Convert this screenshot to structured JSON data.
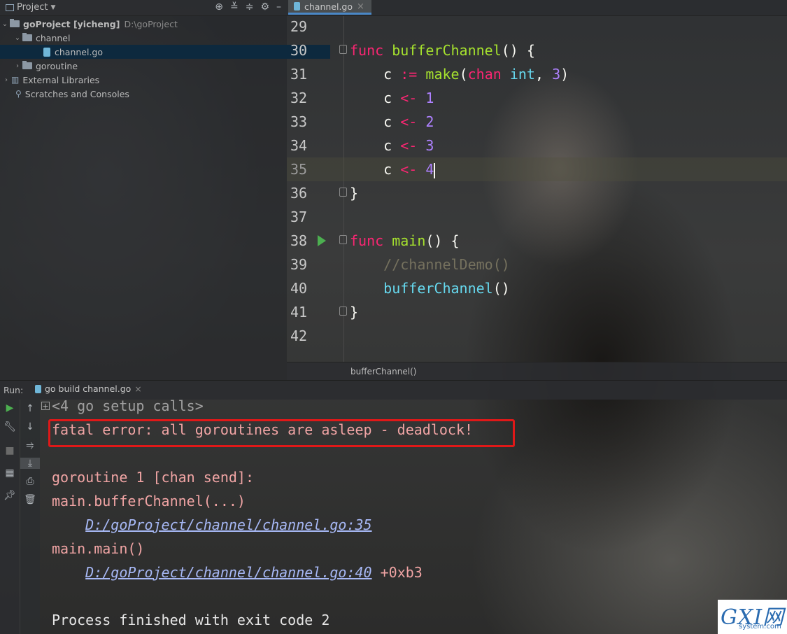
{
  "project_panel": {
    "title": "Project",
    "toolbar_icons": [
      "target-icon",
      "collapse-icon",
      "expand-icon",
      "gear-icon",
      "minimize-icon"
    ],
    "tree": [
      {
        "label": "goProject [yicheng]",
        "path": "D:\\goProject",
        "type": "folder",
        "expanded": true
      },
      {
        "label": "channel",
        "type": "folder",
        "expanded": true
      },
      {
        "label": "channel.go",
        "type": "go-file",
        "selected": true
      },
      {
        "label": "goroutine",
        "type": "folder",
        "expanded": false
      },
      {
        "label": "External Libraries",
        "type": "library",
        "expanded": false
      },
      {
        "label": "Scratches and Consoles",
        "type": "scratches"
      }
    ]
  },
  "editor": {
    "tab": {
      "label": "channel.go",
      "close": "×"
    },
    "lines": [
      {
        "num": "29"
      },
      {
        "num": "30",
        "code": {
          "kw": "func",
          "fn": "bufferChannel",
          "rest": "() {"
        }
      },
      {
        "num": "31",
        "code": {
          "var": "c",
          "op": ":=",
          "fn": "make",
          "kw": "chan",
          "type": "int",
          "num": "3"
        }
      },
      {
        "num": "32",
        "code": {
          "var": "c",
          "op": "<-",
          "num": "1"
        }
      },
      {
        "num": "33",
        "code": {
          "var": "c",
          "op": "<-",
          "num": "2"
        }
      },
      {
        "num": "34",
        "code": {
          "var": "c",
          "op": "<-",
          "num": "3"
        }
      },
      {
        "num": "35",
        "code": {
          "var": "c",
          "op": "<-",
          "num": "4"
        }
      },
      {
        "num": "36",
        "code": {
          "rest": "}"
        }
      },
      {
        "num": "37"
      },
      {
        "num": "38",
        "code": {
          "kw": "func",
          "fn": "main",
          "rest": "() {"
        }
      },
      {
        "num": "39",
        "code": {
          "comment": "//channelDemo()"
        }
      },
      {
        "num": "40",
        "code": {
          "call": "bufferChannel",
          "rest": "()"
        }
      },
      {
        "num": "41",
        "code": {
          "rest": "}"
        }
      },
      {
        "num": "42"
      }
    ],
    "breadcrumb": "bufferChannel()",
    "colors": {
      "keyword": "#f92672",
      "function": "#a6e22e",
      "number": "#ae81ff",
      "type": "#66d9ef",
      "comment": "#75715e"
    }
  },
  "run_panel": {
    "label": "Run:",
    "tab": "go build channel.go",
    "close": "×",
    "side_icons_1": [
      "run-icon",
      "wrench-icon",
      "stop-icon",
      "layout-icon",
      "pin-icon"
    ],
    "side_icons_2": [
      "up-arrow-icon",
      "down-arrow-icon",
      "soft-wrap-icon",
      "scroll-end-icon",
      "print-icon",
      "trash-icon"
    ],
    "console": {
      "setup": "<4 go setup calls>",
      "error": "fatal error: all goroutines are asleep - deadlock!",
      "goroutine": "goroutine 1 [chan send]:",
      "frame1": "main.bufferChannel(...)",
      "link1": "D:/goProject/channel/channel.go:35",
      "frame2": "main.main()",
      "link2": "D:/goProject/channel/channel.go:40",
      "offset": "+0xb3",
      "exit": "Process finished with exit code 2"
    },
    "highlight_color": "#e01818"
  },
  "watermark": {
    "main": "GXI网",
    "sub": "system.com"
  }
}
